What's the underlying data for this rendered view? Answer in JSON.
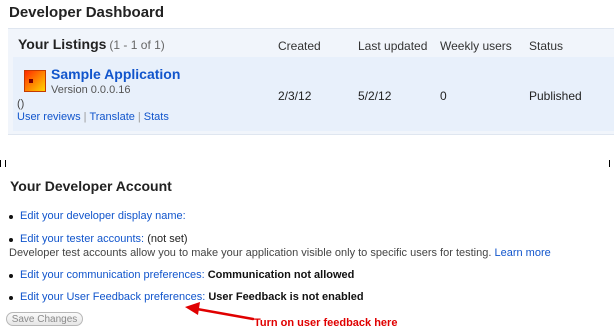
{
  "page_title": "Developer Dashboard",
  "listings": {
    "title": "Your Listings",
    "count": "(1 - 1 of 1)",
    "columns": {
      "created": "Created",
      "last_updated": "Last updated",
      "weekly_users": "Weekly users",
      "status": "Status"
    },
    "rows": [
      {
        "name": "Sample Application",
        "version": "Version 0.0.0.16",
        "parens": "()",
        "links": [
          "User reviews",
          "Translate",
          "Stats"
        ],
        "created": "2/3/12",
        "last_updated": "5/2/12",
        "weekly_users": "0",
        "status": "Published"
      }
    ]
  },
  "account": {
    "title": "Your Developer Account",
    "items": [
      {
        "link": "Edit your developer display name:"
      },
      {
        "link": "Edit your tester accounts:",
        "value": "(not set)",
        "description": "Developer test accounts allow you to make your application visible only to specific users for testing.",
        "learn_more": "Learn more"
      },
      {
        "link": "Edit your communication preferences:",
        "value": "Communication not allowed"
      },
      {
        "link": "Edit your User Feedback preferences:",
        "value": "User Feedback is not enabled"
      }
    ],
    "save_label": "Save Changes"
  },
  "annotation": "Turn on user feedback here",
  "colors": {
    "link": "#1155cc",
    "annotation": "#e00000",
    "panel": "#f1f5fb"
  },
  "icons": {
    "app": "app-icon",
    "arrow": "red-arrow-icon"
  }
}
